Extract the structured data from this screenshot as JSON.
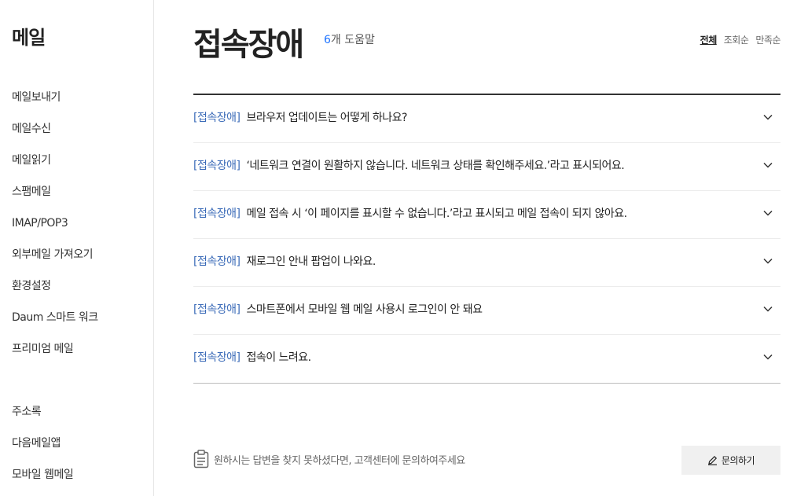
{
  "sidebar": {
    "title": "메일",
    "items": [
      {
        "label": "메일보내기"
      },
      {
        "label": "메일수신"
      },
      {
        "label": "메일읽기"
      },
      {
        "label": "스팸메일"
      },
      {
        "label": "IMAP/POP3"
      },
      {
        "label": "외부메일 가져오기"
      },
      {
        "label": "환경설정"
      },
      {
        "label": "Daum 스마트 워크"
      },
      {
        "label": "프리미엄 메일"
      },
      {
        "label": "접속장애",
        "active": true
      },
      {
        "label": "주소록"
      },
      {
        "label": "다음메일앱"
      },
      {
        "label": "모바일 웹메일"
      }
    ]
  },
  "header": {
    "title": "접속장애",
    "count_number": "6",
    "count_label": "개 도움말",
    "sort": [
      "전체",
      "조회순",
      "만족순"
    ]
  },
  "faqs": [
    {
      "category": "[접속장애]",
      "question": "브라우저 업데이트는 어떻게 하나요?"
    },
    {
      "category": "[접속장애]",
      "question": "‘네트워크 연결이 원활하지 않습니다. 네트워크 상태를 확인해주세요.’라고 표시되어요."
    },
    {
      "category": "[접속장애]",
      "question": "메일 접속 시 ‘이 페이지를 표시할 수 없습니다.’라고 표시되고 메일 접속이 되지 않아요."
    },
    {
      "category": "[접속장애]",
      "question": "재로그인 안내 팝업이 나와요."
    },
    {
      "category": "[접속장애]",
      "question": "스마트폰에서 모바일 웹 메일 사용시 로그인이 안 돼요"
    },
    {
      "category": "[접속장애]",
      "question": "접속이 느려요."
    }
  ],
  "footer": {
    "note": "원하시는 답변을 찾지 못하셨다면, 고객센터에 문의하여주세요",
    "button": "문의하기"
  },
  "colors": {
    "accent": "#1e73ff",
    "category": "#3b6bb8"
  },
  "icons": {
    "chevron": "chevron-down-icon",
    "clipboard": "clipboard-icon",
    "pencil": "pencil-icon"
  }
}
